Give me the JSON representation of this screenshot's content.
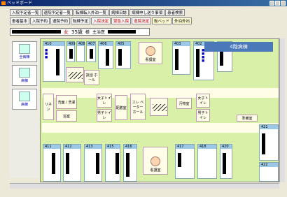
{
  "window": {
    "title": "ベッドボード"
  },
  "menu_row1": [
    "入院予定者一覧",
    "退院予定者一覧",
    "転棟転入外泊一覧",
    "病棟日誌",
    "病棟申し送り事項",
    "患者検索"
  ],
  "menu_row2": [
    "患者基本",
    "入院予約",
    "退院予約",
    "転棟予定",
    "入院決定",
    "緊急入院",
    "退院決定",
    "転ベッド",
    "外泊外出"
  ],
  "patient": {
    "sex": "女",
    "age": "35歳",
    "extra": "様",
    "doctor": "主治医"
  },
  "left_nav": [
    {
      "label": "全病棟"
    },
    {
      "label": "病棟"
    },
    {
      "label": "病棟"
    }
  ],
  "ward": {
    "title": "4階病棟"
  },
  "top_rooms": [
    {
      "num": "410"
    },
    {
      "num": "409"
    },
    {
      "num": "408"
    },
    {
      "num": "407"
    },
    {
      "num": "406"
    },
    {
      "num": "405"
    },
    {
      "num": "403"
    },
    {
      "num": "402"
    },
    {
      "num": "401"
    }
  ],
  "facilities": {
    "nurse_station": "看護室",
    "lounge": "談話 ホール",
    "wash": "洗面 / 洗濯",
    "bath": "浴室",
    "linen": "リネン",
    "elevator": "エレ ベーター ホール",
    "women_wc": "女子トイレ",
    "men_wc": "男子トイレ",
    "kitchen": "配膳室",
    "staff": "準備室",
    "utility": "汚物室"
  },
  "bottom_rooms": [
    {
      "num": "411"
    },
    {
      "num": "412"
    },
    {
      "num": "413"
    },
    {
      "num": "415"
    },
    {
      "num": "416"
    },
    {
      "num": "417"
    },
    {
      "num": "418"
    },
    {
      "num": "420"
    }
  ],
  "right_rooms": [
    {
      "num": "421"
    },
    {
      "num": "422"
    }
  ]
}
